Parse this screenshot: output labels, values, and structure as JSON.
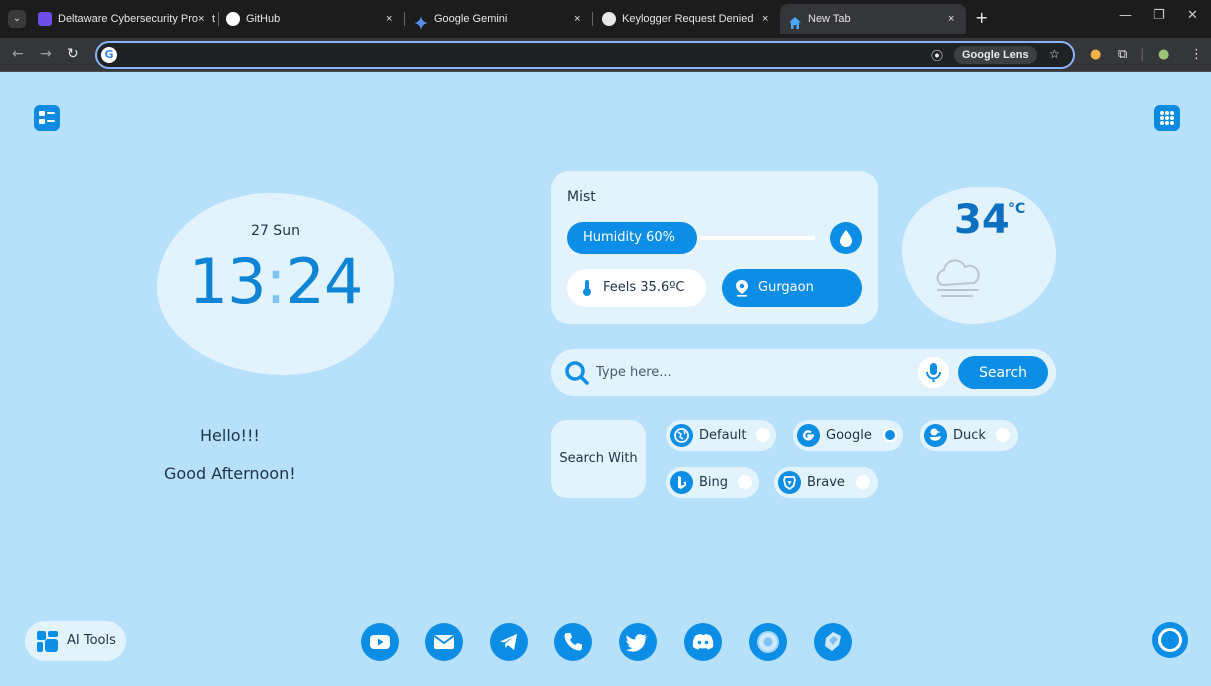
{
  "browser": {
    "tabs": [
      {
        "title": "Deltaware Cybersecurity Project",
        "close": "×"
      },
      {
        "title": "GitHub",
        "close": "×"
      },
      {
        "title": "Google Gemini",
        "close": "×"
      },
      {
        "title": "Keylogger Request Denied",
        "close": "×"
      },
      {
        "title": "New Tab",
        "close": "×"
      }
    ],
    "new_tab_label": "+",
    "google_lens_label": "Google Lens",
    "omnibox_value": ""
  },
  "colors": {
    "background": "#b7e0fb",
    "card": "#e3f3fe",
    "accent": "#0d8ee6",
    "text": "#1f3347"
  },
  "clock": {
    "date": "27 Sun",
    "hours": "13",
    "separator": ":",
    "minutes": "24"
  },
  "greeting": {
    "line1": "Hello!!!",
    "line2": "Good Afternoon!"
  },
  "weather": {
    "condition": "Mist",
    "humidity_label": "Humidity 60%",
    "humidity_level": 0.6,
    "feels_like": "Feels 35.6ºC",
    "location": "Gurgaon",
    "temperature": "34",
    "unit": "°C",
    "icon": "cloud-icon"
  },
  "search": {
    "placeholder": "Type here...",
    "button_label": "Search"
  },
  "search_with": {
    "label": "Search With",
    "engines": [
      {
        "name": "Default",
        "icon": "globe-icon",
        "selected": false
      },
      {
        "name": "Google",
        "icon": "google-icon",
        "selected": true
      },
      {
        "name": "Duck",
        "icon": "duck-icon",
        "selected": false
      },
      {
        "name": "Bing",
        "icon": "bing-icon",
        "selected": false
      },
      {
        "name": "Brave",
        "icon": "brave-icon",
        "selected": false
      }
    ]
  },
  "ai_tools": {
    "label": "AI Tools"
  },
  "shortcuts": [
    "youtube-icon",
    "mail-icon",
    "telegram-icon",
    "whatsapp-icon",
    "twitter-icon",
    "discord-icon",
    "chromium-icon",
    "gemini-icon"
  ]
}
